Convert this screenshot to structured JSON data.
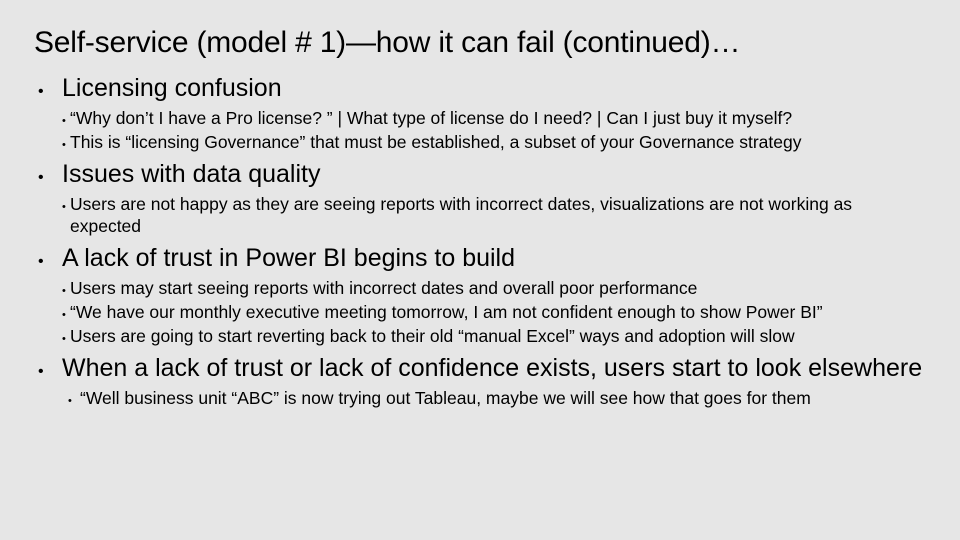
{
  "title": "Self-service (model # 1)—how it can fail (continued)…",
  "bullets": [
    {
      "heading": "Licensing confusion",
      "sub": [
        "“Why don’t I have a Pro license? ” | What type of license do I need? | Can I just buy it myself?",
        "This is “licensing Governance” that must be established, a subset of your Governance strategy"
      ]
    },
    {
      "heading": "Issues with data quality",
      "sub": [
        "Users are not happy as they are seeing reports with incorrect dates, visualizations are not working as expected"
      ]
    },
    {
      "heading": "A lack of trust in Power BI begins to build",
      "sub": [
        "Users may start seeing reports with incorrect dates and overall poor performance",
        "“We have our monthly executive meeting tomorrow, I am not confident enough to show Power BI”",
        "Users are going to start reverting back to their old “manual Excel” ways and adoption will slow"
      ]
    },
    {
      "heading": "When a lack of trust or lack of confidence exists, users start to look elsewhere",
      "sub": [
        "“Well business unit “ABC” is now trying out Tableau, maybe we will see how that goes for them"
      ],
      "indent_extra": true
    }
  ]
}
